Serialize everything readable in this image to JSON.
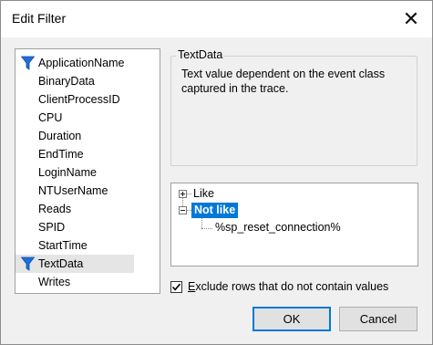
{
  "window": {
    "title": "Edit Filter",
    "close_glyph": "✕"
  },
  "columns": {
    "items": [
      {
        "label": "ApplicationName",
        "filtered": true,
        "selected": false
      },
      {
        "label": "BinaryData",
        "filtered": false,
        "selected": false
      },
      {
        "label": "ClientProcessID",
        "filtered": false,
        "selected": false
      },
      {
        "label": "CPU",
        "filtered": false,
        "selected": false
      },
      {
        "label": "Duration",
        "filtered": false,
        "selected": false
      },
      {
        "label": "EndTime",
        "filtered": false,
        "selected": false
      },
      {
        "label": "LoginName",
        "filtered": false,
        "selected": false
      },
      {
        "label": "NTUserName",
        "filtered": false,
        "selected": false
      },
      {
        "label": "Reads",
        "filtered": false,
        "selected": false
      },
      {
        "label": "SPID",
        "filtered": false,
        "selected": false
      },
      {
        "label": "StartTime",
        "filtered": false,
        "selected": false
      },
      {
        "label": "TextData",
        "filtered": true,
        "selected": true
      },
      {
        "label": "Writes",
        "filtered": false,
        "selected": false
      }
    ],
    "filter_icon": "funnel-filter-icon",
    "filter_color": "#1e6fd9"
  },
  "details": {
    "group_title": "TextData",
    "description": "Text value dependent on the event class captured in the trace."
  },
  "tree": {
    "like_label": "Like",
    "not_like_label": "Not like",
    "not_like_value": "%sp_reset_connection%",
    "selection_color": "#0078d7"
  },
  "options": {
    "exclude_prefix": "E",
    "exclude_rest": "xclude rows that do not contain values",
    "exclude_checked": true
  },
  "buttons": {
    "ok": "OK",
    "cancel": "Cancel"
  }
}
